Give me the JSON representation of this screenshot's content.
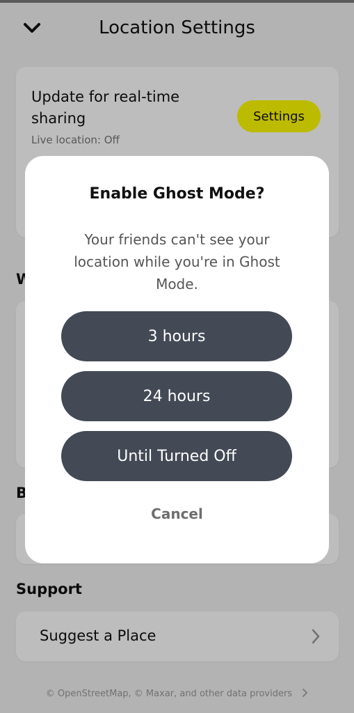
{
  "header": {
    "title": "Location Settings",
    "back_icon": "chevron-down-icon"
  },
  "update_card": {
    "title": "Update for real-time sharing",
    "subtitle": "Live location: Off",
    "settings_label": "Settings",
    "settings_color": "#fffc00"
  },
  "sections": {
    "w_label": "W",
    "b_label": "B",
    "support_label": "Support"
  },
  "support": {
    "suggest_label": "Suggest a Place",
    "chevron_icon": "chevron-right-icon"
  },
  "footer": {
    "credit": "© OpenStreetMap, © Maxar, and other data providers"
  },
  "modal": {
    "title": "Enable Ghost Mode?",
    "description": "Your friends can't see your location while you're in Ghost Mode.",
    "options": [
      "3 hours",
      "24 hours",
      "Until Turned Off"
    ],
    "option_color": "#434a55",
    "cancel_label": "Cancel"
  }
}
